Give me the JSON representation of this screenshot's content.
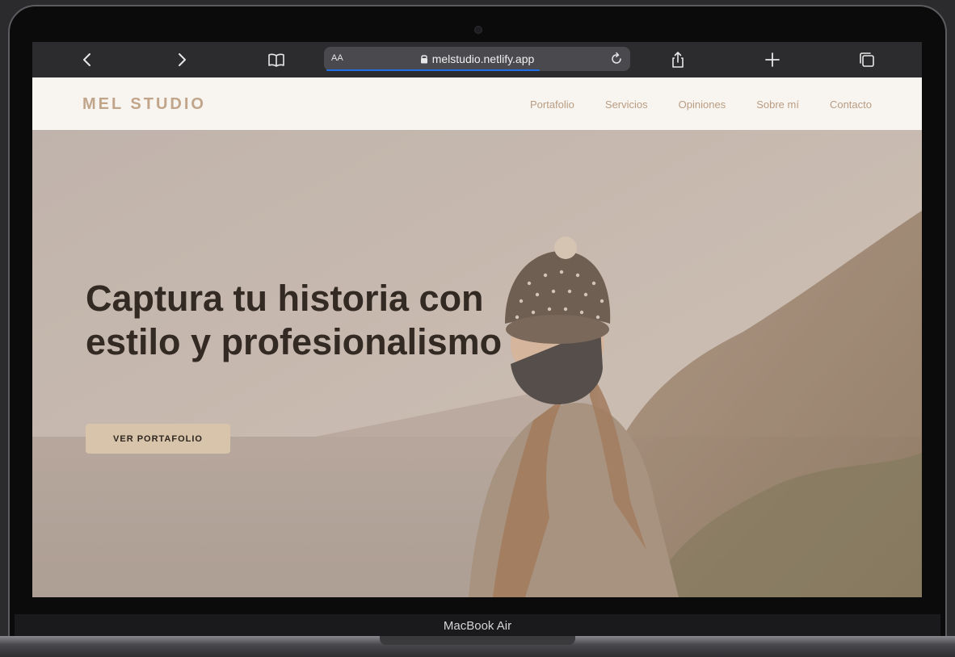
{
  "browser": {
    "url": "melstudio.netlify.app",
    "text_size_label": "AA",
    "icons": [
      "chevron-left-icon",
      "chevron-right-icon",
      "book-icon",
      "lock-icon",
      "reload-icon",
      "share-icon",
      "plus-icon",
      "tabs-icon"
    ],
    "accent_color": "#1f6fe8"
  },
  "site": {
    "logo": "MEL STUDIO",
    "nav": [
      "Portafolio",
      "Servicios",
      "Opiniones",
      "Sobre mí",
      "Contacto"
    ],
    "hero": {
      "title": "Captura tu historia con estilo y profesionalismo",
      "cta": "VER PORTAFOLIO"
    },
    "colors": {
      "header_bg": "#f8f4f0",
      "brand": "#c1a58b",
      "cta_bg": "#d8c4ab",
      "title": "#332a24"
    }
  },
  "device": {
    "label": "MacBook Air"
  }
}
